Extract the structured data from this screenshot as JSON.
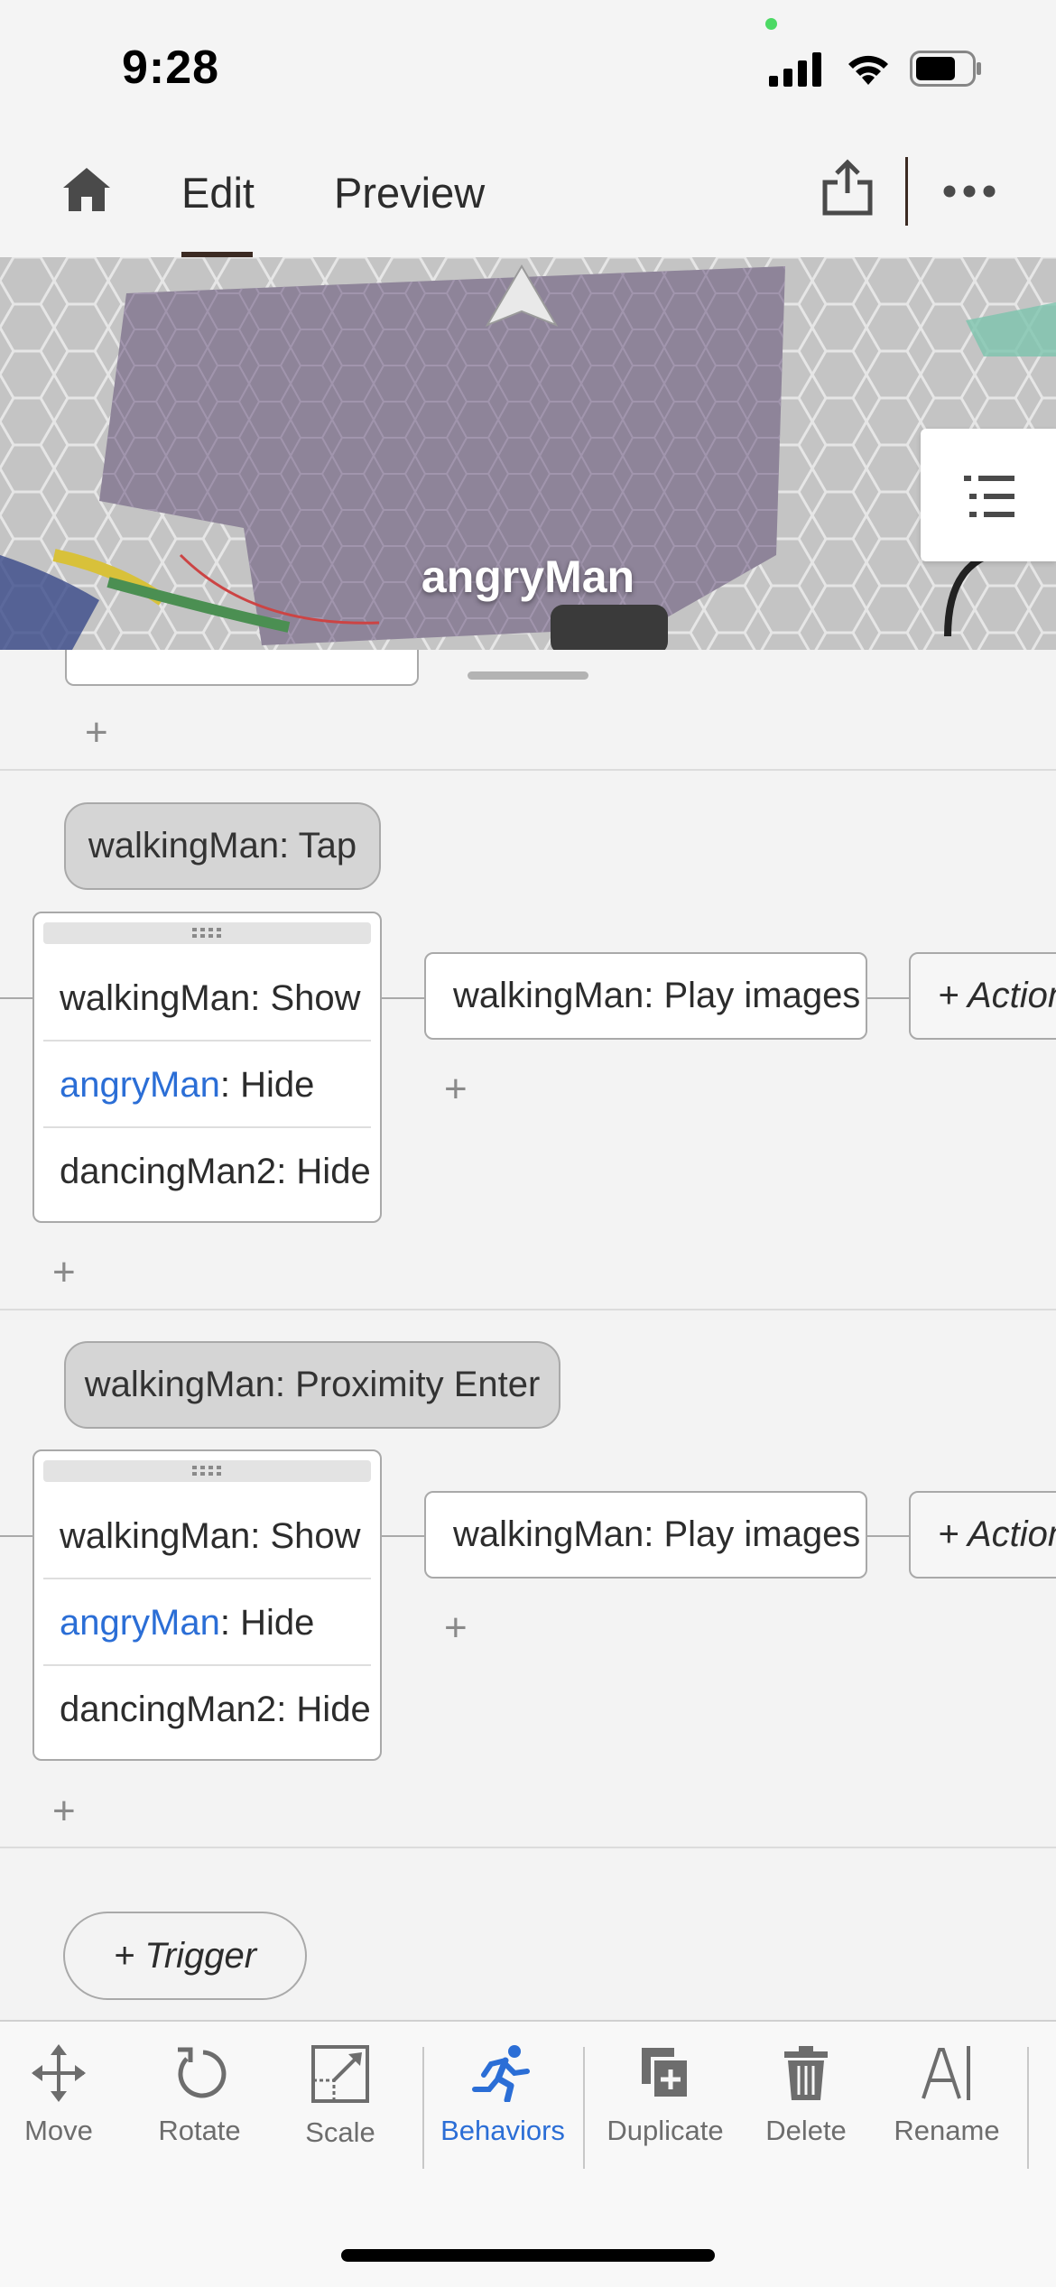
{
  "status_bar": {
    "time": "9:28"
  },
  "header": {
    "tabs": [
      {
        "label": "Edit",
        "active": true
      },
      {
        "label": "Preview",
        "active": false
      }
    ]
  },
  "scene": {
    "selected_object_label": "angryMan"
  },
  "behaviors": [
    {
      "trigger": "walkingMan: Tap",
      "action_group": [
        {
          "object": "walkingMan",
          "verb": "Show",
          "highlight": false
        },
        {
          "object": "angryMan",
          "verb": "Hide",
          "highlight": true
        },
        {
          "object": "dancingMan2",
          "verb": "Hide",
          "highlight": false
        }
      ],
      "next_action": "walkingMan: Play images",
      "add_action_label": "+ Action"
    },
    {
      "trigger": "walkingMan: Proximity Enter",
      "action_group": [
        {
          "object": "walkingMan",
          "verb": "Show",
          "highlight": false
        },
        {
          "object": "angryMan",
          "verb": "Hide",
          "highlight": true
        },
        {
          "object": "dancingMan2",
          "verb": "Hide",
          "highlight": false
        }
      ],
      "next_action": "walkingMan: Play images",
      "add_action_label": "+ Action"
    }
  ],
  "add_trigger_label": "+ Trigger",
  "plus_symbol": "+",
  "toolbar": {
    "items": [
      {
        "label": "Move",
        "icon": "move-icon",
        "active": false
      },
      {
        "label": "Rotate",
        "icon": "rotate-icon",
        "active": false
      },
      {
        "label": "Scale",
        "icon": "scale-icon",
        "active": false
      },
      {
        "label": "Behaviors",
        "icon": "running-person-icon",
        "active": true
      },
      {
        "label": "Duplicate",
        "icon": "duplicate-icon",
        "active": false
      },
      {
        "label": "Delete",
        "icon": "trash-icon",
        "active": false
      },
      {
        "label": "Rename",
        "icon": "rename-icon",
        "active": false
      }
    ]
  },
  "colors": {
    "accent": "#2b6ed6",
    "tab_underline": "#3b2a22",
    "trigger_fill": "#d5d5d5"
  }
}
